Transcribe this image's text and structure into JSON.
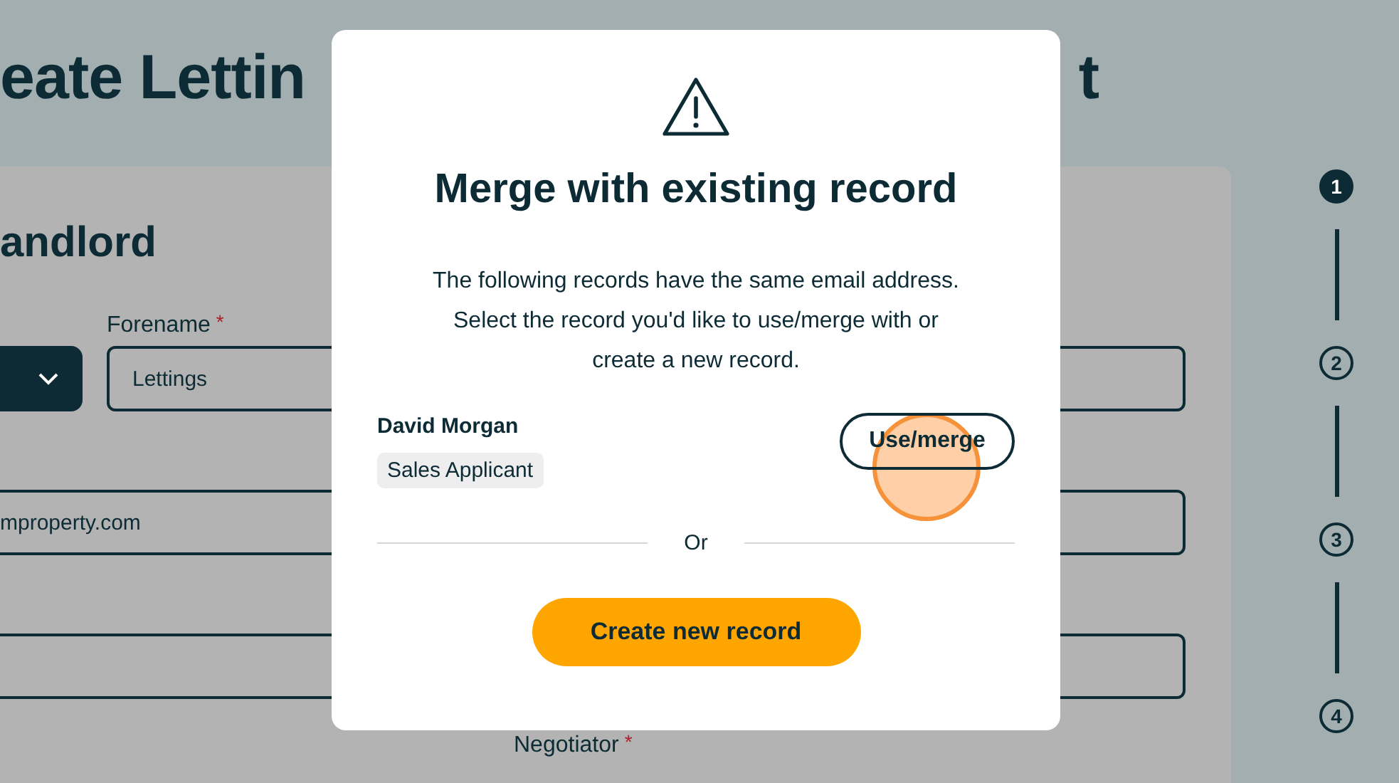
{
  "page_title": {
    "left_fragment": "eate Lettin",
    "right_fragment": "t"
  },
  "form": {
    "section_title": "andlord",
    "forename": {
      "label": "Forename",
      "required_mark": "*",
      "value": "Lettings"
    },
    "email": {
      "value": "mproperty.com"
    },
    "negotiator": {
      "label": "Negotiator",
      "required_mark": "*"
    }
  },
  "stepper": [
    {
      "number": "1",
      "selected": true
    },
    {
      "number": "2",
      "selected": false
    },
    {
      "number": "3",
      "selected": false
    },
    {
      "number": "4",
      "selected": false
    }
  ],
  "modal": {
    "title": "Merge with existing record",
    "message_lines": [
      "The following records have the same email address.",
      "Select the record you'd like to use/merge with or",
      "create a new record."
    ],
    "record": {
      "name": "David Morgan",
      "tag": "Sales Applicant",
      "action": "Use/merge"
    },
    "separator": "Or",
    "primary_button": "Create new record"
  }
}
